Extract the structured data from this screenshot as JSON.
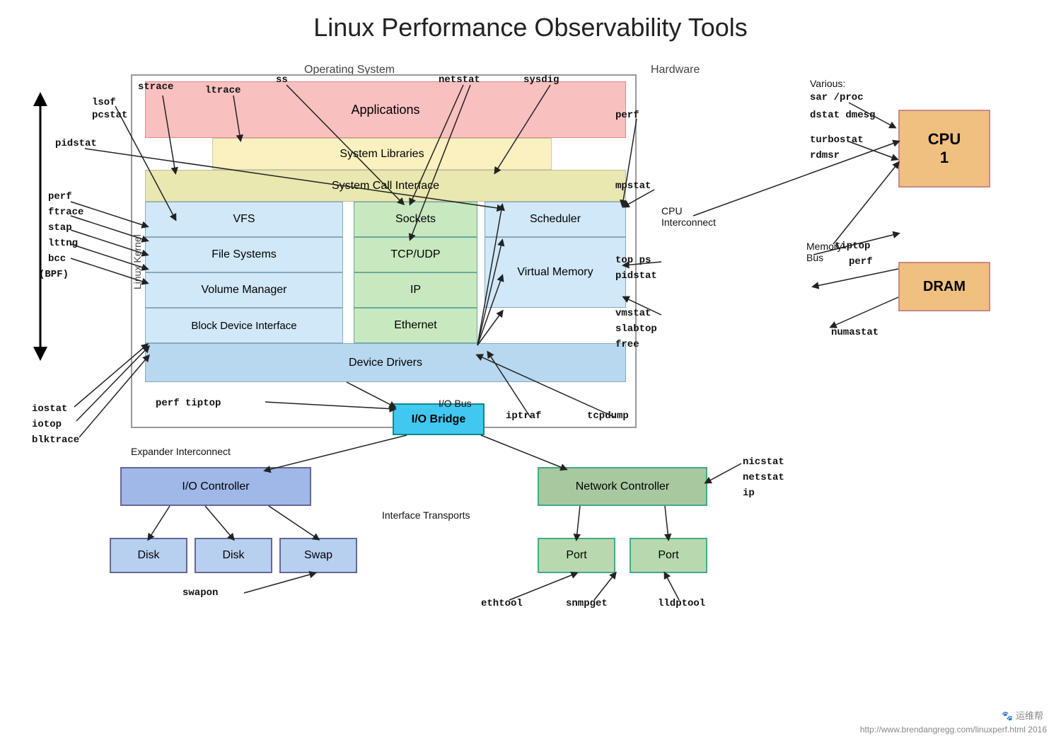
{
  "title": "Linux Performance Observability Tools",
  "labels": {
    "os": "Operating System",
    "hardware": "Hardware",
    "various": "Various:",
    "kernel": "Linux Kernel",
    "cpu_interconnect": "CPU\nInterconnect",
    "memory_bus": "Memory\nBus",
    "expander": "Expander Interconnect",
    "interface_transports": "Interface Transports",
    "io_bus": "I/O Bus"
  },
  "layers": {
    "applications": "Applications",
    "system_libraries": "System Libraries",
    "syscall_interface": "System Call Interface",
    "vfs": "VFS",
    "sockets": "Sockets",
    "scheduler": "Scheduler",
    "file_systems": "File Systems",
    "tcp_udp": "TCP/UDP",
    "virtual_memory": "Virtual\nMemory",
    "volume_manager": "Volume Manager",
    "ip": "IP",
    "block_device": "Block Device Interface",
    "ethernet": "Ethernet",
    "device_drivers": "Device Drivers"
  },
  "boxes": {
    "io_bridge": "I/O Bridge",
    "io_controller": "I/O Controller",
    "disk1": "Disk",
    "disk2": "Disk",
    "swap": "Swap",
    "net_controller": "Network Controller",
    "port1": "Port",
    "port2": "Port",
    "cpu": "CPU\n1",
    "dram": "DRAM"
  },
  "tools": {
    "strace": "strace",
    "ss": "ss",
    "ltrace": "ltrace",
    "lsof": "lsof",
    "pcstat": "pcstat",
    "pidstat_top": "pidstat",
    "netstat": "netstat",
    "sysdig": "sysdig",
    "perf_top": "perf",
    "perf_kernel": "perf",
    "ftrace": "ftrace",
    "stap": "stap",
    "lttng": "lttng",
    "bcc": "bcc",
    "bpf": "(BPF)",
    "iostat": "iostat",
    "iotop": "iotop",
    "blktrace": "blktrace",
    "perf_tiptop": "perf  tiptop",
    "iptraf": "iptraf",
    "tcpdump": "tcpdump",
    "mpstat": "mpstat",
    "top_ps": "top ps",
    "pidstat_mid": "pidstat",
    "vmstat": "vmstat",
    "slabtop": "slabtop",
    "free": "free",
    "sar_proc": "sar /proc",
    "dstat_dmesg": "dstat dmesg",
    "turbostat": "turbostat",
    "rdmsr": "rdmsr",
    "tiptop_right": "tiptop",
    "perf_right": "perf",
    "numastat": "numastat",
    "nicstat": "nicstat",
    "netstat_right": "netstat",
    "ip_right": "ip",
    "swapon": "swapon",
    "ethtool": "ethtool",
    "snmpget": "snmpget",
    "lldptool": "lldptool"
  },
  "watermark": "http://www.brendangregg.com/linuxperf.html 2016",
  "brand": "运维帮"
}
